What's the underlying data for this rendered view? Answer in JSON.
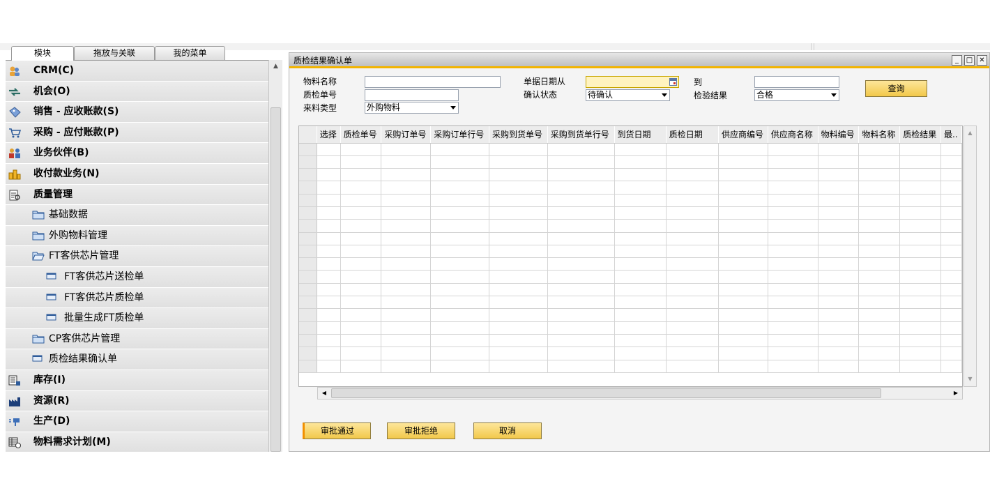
{
  "left_tabs": [
    "模块",
    "拖放与关联",
    "我的菜单"
  ],
  "tree": [
    {
      "label": "CRM(C)",
      "icon": "crm-icon"
    },
    {
      "label": "机会(O)",
      "icon": "opportunity-icon"
    },
    {
      "label": "销售 - 应收账款(S)",
      "icon": "sales-icon"
    },
    {
      "label": "采购 - 应付账款(P)",
      "icon": "cart-icon"
    },
    {
      "label": "业务伙伴(B)",
      "icon": "partners-icon"
    },
    {
      "label": "收付款业务(N)",
      "icon": "payments-icon"
    },
    {
      "label": "质量管理",
      "icon": "quality-icon"
    },
    {
      "label": "基础数据",
      "icon": "folder-icon"
    },
    {
      "label": "外购物料管理",
      "icon": "folder-icon"
    },
    {
      "label": "FT客供芯片管理",
      "icon": "folder-open-icon"
    },
    {
      "label": "FT客供芯片送检单",
      "icon": "form-icon"
    },
    {
      "label": "FT客供芯片质检单",
      "icon": "form-icon"
    },
    {
      "label": "批量生成FT质检单",
      "icon": "form-icon"
    },
    {
      "label": "CP客供芯片管理",
      "icon": "folder-icon"
    },
    {
      "label": "质检结果确认单",
      "icon": "form-icon"
    },
    {
      "label": "库存(I)",
      "icon": "inventory-icon"
    },
    {
      "label": "资源(R)",
      "icon": "resources-icon"
    },
    {
      "label": "生产(D)",
      "icon": "production-icon"
    },
    {
      "label": "物料需求计划(M)",
      "icon": "mrp-icon"
    }
  ],
  "window": {
    "title": "质检结果确认单",
    "buttons": {
      "minimize": "_",
      "maximize": "□",
      "close": "✕"
    }
  },
  "form": {
    "material_name_label": "物料名称",
    "material_name_value": "",
    "qc_no_label": "质检单号",
    "qc_no_value": "",
    "source_type_label": "来料类型",
    "source_type_value": "外购物料",
    "date_from_label": "单据日期从",
    "date_from_value": "",
    "confirm_status_label": "确认状态",
    "confirm_status_value": "待确认",
    "date_to_label": "到",
    "date_to_value": "",
    "inspect_result_label": "检验结果",
    "inspect_result_value": "合格",
    "query_button": "查询"
  },
  "grid": {
    "columns": [
      "选择",
      "质检单号",
      "采购订单号",
      "采购订单行号",
      "采购到货单号",
      "采购到货单行号",
      "到货日期",
      "质检日期",
      "供应商编号",
      "供应商名称",
      "物料编号",
      "物料名称",
      "质检结果",
      "最.."
    ],
    "row_count": 18
  },
  "actions": {
    "approve": "审批通过",
    "reject": "审批拒绝",
    "cancel": "取消"
  },
  "colors": {
    "accent_gold": "#f2b400",
    "button_gold": "#f2c84a",
    "panel_gray": "#e9e9e9"
  }
}
